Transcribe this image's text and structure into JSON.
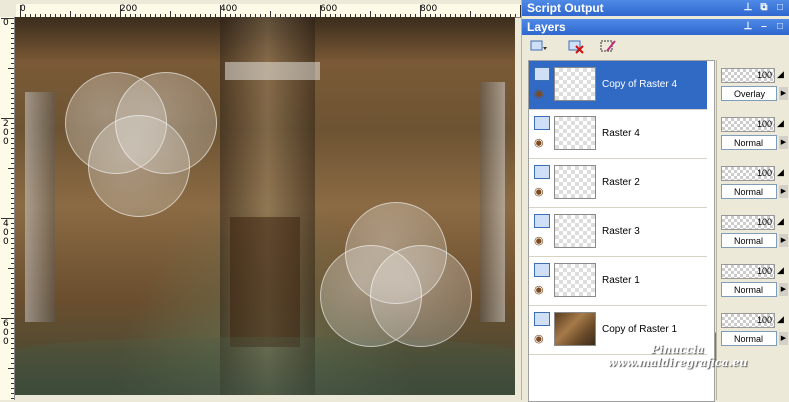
{
  "ruler": {
    "h_labels": [
      "0",
      "200",
      "400",
      "600",
      "800"
    ],
    "v_labels": [
      "0",
      "2 0 0",
      "4 0 0",
      "6 0 0"
    ]
  },
  "script_output": {
    "title": "Script Output"
  },
  "layers_panel": {
    "title": "Layers",
    "toolbar": [
      "new-layer-icon",
      "delete-layer-icon",
      "edit-selection-icon"
    ],
    "layers": [
      {
        "name": "Copy of Raster 4",
        "opacity": "100",
        "blend": "Overlay",
        "selected": true
      },
      {
        "name": "Raster 4",
        "opacity": "100",
        "blend": "Normal",
        "selected": false
      },
      {
        "name": "Raster 2",
        "opacity": "100",
        "blend": "Normal",
        "selected": false
      },
      {
        "name": "Raster 3",
        "opacity": "100",
        "blend": "Normal",
        "selected": false
      },
      {
        "name": "Raster 1",
        "opacity": "100",
        "blend": "Normal",
        "selected": false
      },
      {
        "name": "Copy of Raster 1",
        "opacity": "100",
        "blend": "Normal",
        "selected": false
      }
    ]
  },
  "watermark": {
    "line1": "Pinuccia",
    "line2": "www.maldiregrafica.eu"
  },
  "colors": {
    "title_bar": "#2f67cf",
    "selected_row": "#316ac5"
  }
}
